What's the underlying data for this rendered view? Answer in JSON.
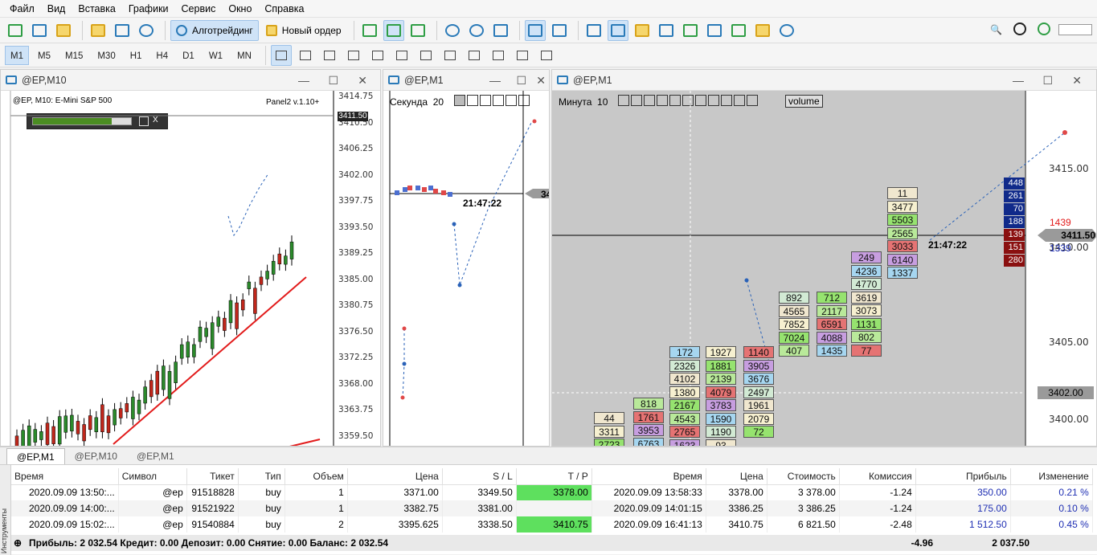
{
  "menu": [
    "Файл",
    "Вид",
    "Вставка",
    "Графики",
    "Сервис",
    "Окно",
    "Справка"
  ],
  "toolbar": {
    "algo_label": "Алготрейдинг",
    "new_order_label": "Новый ордер",
    "timeframes": [
      "M1",
      "M5",
      "M15",
      "M30",
      "H1",
      "H4",
      "D1",
      "W1",
      "MN"
    ]
  },
  "windows": {
    "m10": {
      "title": "@EP,M10",
      "subtitle": "@EP, M10:  E-Mini S&P 500",
      "panel_label": "Panel2 v.1.10+",
      "current_price": "3411.50",
      "price_labels": [
        "3414.75",
        "3410.50",
        "3406.25",
        "3402.00",
        "3397.75",
        "3393.50",
        "3389.25",
        "3385.00",
        "3380.75",
        "3376.50",
        "3372.25",
        "3368.00",
        "3363.75",
        "3359.50"
      ]
    },
    "sec": {
      "title": "@EP,M1",
      "mode_label": "Секунда",
      "mode_value": "20",
      "time_label": "21:47:22",
      "price_stub": "34"
    },
    "min": {
      "title": "@EP,M1",
      "mode_label": "Минута",
      "mode_value": "10",
      "volume_label": "volume",
      "time_label": "21:47:22",
      "current_price": "3411.50",
      "level_price": "3402.00",
      "ask_size": "1439",
      "bid_size": "1339",
      "price_labels": [
        "3415.00",
        "3410.00",
        "3405.00",
        "3400.00"
      ],
      "dom_asks": [
        "448",
        "261",
        "70",
        "188"
      ],
      "dom_bids": [
        "139",
        "151",
        "280"
      ]
    }
  },
  "footprint": [
    {
      "col": 0,
      "cells": [
        "44",
        "3311",
        "2723"
      ]
    },
    {
      "col": 1,
      "cells": [
        "818",
        "1761",
        "3953",
        "6763"
      ]
    },
    {
      "col": 2,
      "cells": [
        "172",
        "2326",
        "4102",
        "1380",
        "2167",
        "4543",
        "2765",
        "1623"
      ]
    },
    {
      "col": 3,
      "cells": [
        "1927",
        "1881",
        "2139",
        "4079",
        "3783",
        "1590",
        "1190",
        "93"
      ]
    },
    {
      "col": 4,
      "cells": [
        "1140",
        "3905",
        "3676",
        "2497",
        "1961",
        "2079",
        "72"
      ]
    },
    {
      "col": 5,
      "cells": [
        "892",
        "4565",
        "7852",
        "7024",
        "407"
      ]
    },
    {
      "col": 6,
      "cells": [
        "712",
        "2117",
        "6591",
        "4088",
        "1435"
      ]
    },
    {
      "col": 7,
      "cells": [
        "249",
        "4236",
        "4770",
        "3619",
        "3073",
        "1131",
        "802",
        "77"
      ]
    },
    {
      "col": 8,
      "cells": [
        "11",
        "3477",
        "5503",
        "2565",
        "3033",
        "6140",
        "1337"
      ]
    }
  ],
  "tabs": [
    "@EP,M1",
    "@EP,M10",
    "@EP,M1"
  ],
  "terminal": {
    "side_label": "Инструменты",
    "columns": [
      "Время",
      "Символ",
      "Тикет",
      "Тип",
      "Объем",
      "Цена",
      "S / L",
      "T / P",
      "Время",
      "Цена",
      "Стоимость",
      "Комиссия",
      "Прибыль",
      "Изменение"
    ],
    "rows": [
      [
        "2020.09.09 13:50:...",
        "@ep",
        "91518828",
        "buy",
        "1",
        "3371.00",
        "3349.50",
        "3378.00",
        "2020.09.09 13:58:33",
        "3378.00",
        "3 378.00",
        "-1.24",
        "350.00",
        "0.21 %"
      ],
      [
        "2020.09.09 14:00:...",
        "@ep",
        "91521922",
        "buy",
        "1",
        "3382.75",
        "3381.00",
        "",
        "2020.09.09 14:01:15",
        "3386.25",
        "3 386.25",
        "-1.24",
        "175.00",
        "0.10 %"
      ],
      [
        "2020.09.09 15:02:...",
        "@ep",
        "91540884",
        "buy",
        "2",
        "3395.625",
        "3338.50",
        "3410.75",
        "2020.09.09 16:41:13",
        "3410.75",
        "6 821.50",
        "-2.48",
        "1 512.50",
        "0.45 %"
      ]
    ],
    "summary": "Прибыль: 2 032.54  Кредит: 0.00  Депозит: 0.00  Снятие: 0.00  Баланс: 2 032.54",
    "summary_commission": "-4.96",
    "summary_profit": "2 037.50"
  }
}
